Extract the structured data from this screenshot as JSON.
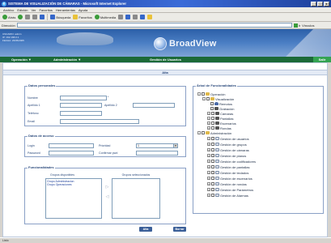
{
  "window": {
    "title": "SISTEMA DE VISUALIZACIÓN DE CÁMARAS - Microsoft Internet Explorer",
    "buttons": [
      "_",
      "□",
      "x"
    ]
  },
  "menubar": [
    "Archivo",
    "Edición",
    "Ver",
    "Favoritos",
    "Herramientas",
    "Ayuda"
  ],
  "toolbar": {
    "back_label": "Atrás",
    "search_label": "Búsqueda",
    "favorites_label": "Favoritos",
    "multimedia_label": "Multimedia"
  },
  "addressbar": {
    "label": "Dirección",
    "value": "",
    "go_label": "Ir",
    "links_label": "Vínculos"
  },
  "header": {
    "info_line1": "USUARIO: admin",
    "info_line2": "IP: 192.168.0.1",
    "info_line3": "FECHA: 23/05/2005",
    "logo_text": "BroadView"
  },
  "navbar": {
    "operacion": "Operación ▼",
    "administracion": "Administración ▼",
    "title": "Gestión de Usuarios",
    "exit": "Salir"
  },
  "form": {
    "mode_title": "Alta",
    "personal": {
      "legend": "Datos personales",
      "nombre": "Nombre",
      "apellido1": "Apellido 1",
      "apellido2": "Apellido 2",
      "telefono": "Teléfono",
      "email": "Email"
    },
    "acceso": {
      "legend": "Datos de acceso",
      "login": "Login",
      "password": "Password",
      "prioridad": "Prioridad",
      "prioridad_value": "1",
      "confirmar": "Confirmar pwd"
    },
    "funcionalidades": {
      "legend": "Funcionalidades",
      "disponibles_head": "Grupos disponibles",
      "seleccionados_head": "Grupos seleccionados",
      "disponibles": [
        "Grupo Administracion",
        "Grupo Operaciones"
      ],
      "seleccionados": [],
      "add_arrow": "▷",
      "remove_arrow": "◁"
    },
    "tree": {
      "legend": "Árbol de Funcionalidades",
      "nodes": [
        {
          "label": "Operación",
          "icon": "folder-icon"
        },
        {
          "label": "Visualización",
          "icon": "folder-icon"
        },
        {
          "label": "Remotos",
          "icon": "user-icon"
        },
        {
          "label": "Grabación",
          "icon": "camera-icon"
        },
        {
          "label": "Cámaras",
          "icon": "camera-icon"
        },
        {
          "label": "Pantallas",
          "icon": "camera-icon"
        },
        {
          "label": "Escenarios",
          "icon": "camera-icon"
        },
        {
          "label": "Rondas",
          "icon": "camera-icon"
        },
        {
          "label": "Administración",
          "icon": "folder-icon"
        },
        {
          "label": "Gestión de usuarios",
          "icon": "doc-icon"
        },
        {
          "label": "Gestión de grupos",
          "icon": "doc-icon"
        },
        {
          "label": "Gestión de cámaras",
          "icon": "doc-icon"
        },
        {
          "label": "Gestión de planos",
          "icon": "doc-icon"
        },
        {
          "label": "Gestión de codificadores",
          "icon": "doc-icon"
        },
        {
          "label": "Gestión de pantallas",
          "icon": "doc-icon"
        },
        {
          "label": "Gestión de teclados",
          "icon": "doc-icon"
        },
        {
          "label": "Gestión de escenarios",
          "icon": "doc-icon"
        },
        {
          "label": "Gestión de rondas",
          "icon": "doc-icon"
        },
        {
          "label": "Gestión de Parámetros",
          "icon": "doc-icon"
        },
        {
          "label": "Gestión de Alarmas",
          "icon": "doc-icon"
        }
      ]
    },
    "buttons": {
      "alta": "Alta",
      "borrar": "Borrar"
    }
  },
  "statusbar": {
    "text": "Listo"
  },
  "colors": {
    "nav_green": "#1c6a38",
    "exit_green": "#34a352",
    "header_blue": "#2c5fa8",
    "button_blue": "#3b5f98"
  }
}
